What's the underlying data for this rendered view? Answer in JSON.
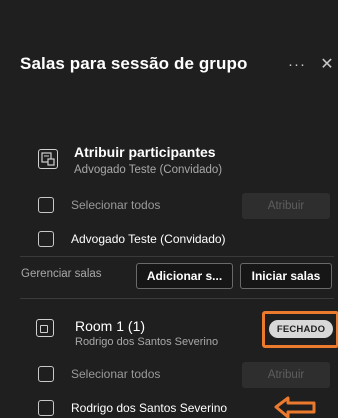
{
  "header": {
    "title": "Salas para sessão de grupo",
    "more_glyph": "···",
    "close_glyph": "✕"
  },
  "assign_section": {
    "title": "Atribuir participantes",
    "subtitle": "Advogado Teste (Convidado)",
    "icon": "assign-participants-icon",
    "select_all_label": "Selecionar todos",
    "assign_button": "Atribuir",
    "participants": [
      {
        "name": "Advogado Teste (Convidado)",
        "checked": false
      }
    ]
  },
  "manage": {
    "label": "Gerenciar salas",
    "add_button": "Adicionar s...",
    "start_button": "Iniciar salas"
  },
  "room": {
    "title": "Room 1 (1)",
    "member": "Rodrigo dos Santos Severino",
    "status": "FECHADO",
    "icon": "room-icon",
    "select_all_label": "Selecionar todos",
    "assign_button": "Atribuir",
    "participants": [
      {
        "name": "Rodrigo dos Santos Severino",
        "checked": false
      }
    ]
  },
  "colors": {
    "background": "#1f1f1f",
    "highlight": "#ec7a2e",
    "badge": "#d8d8d8",
    "muted_text": "#a8a8a8"
  }
}
